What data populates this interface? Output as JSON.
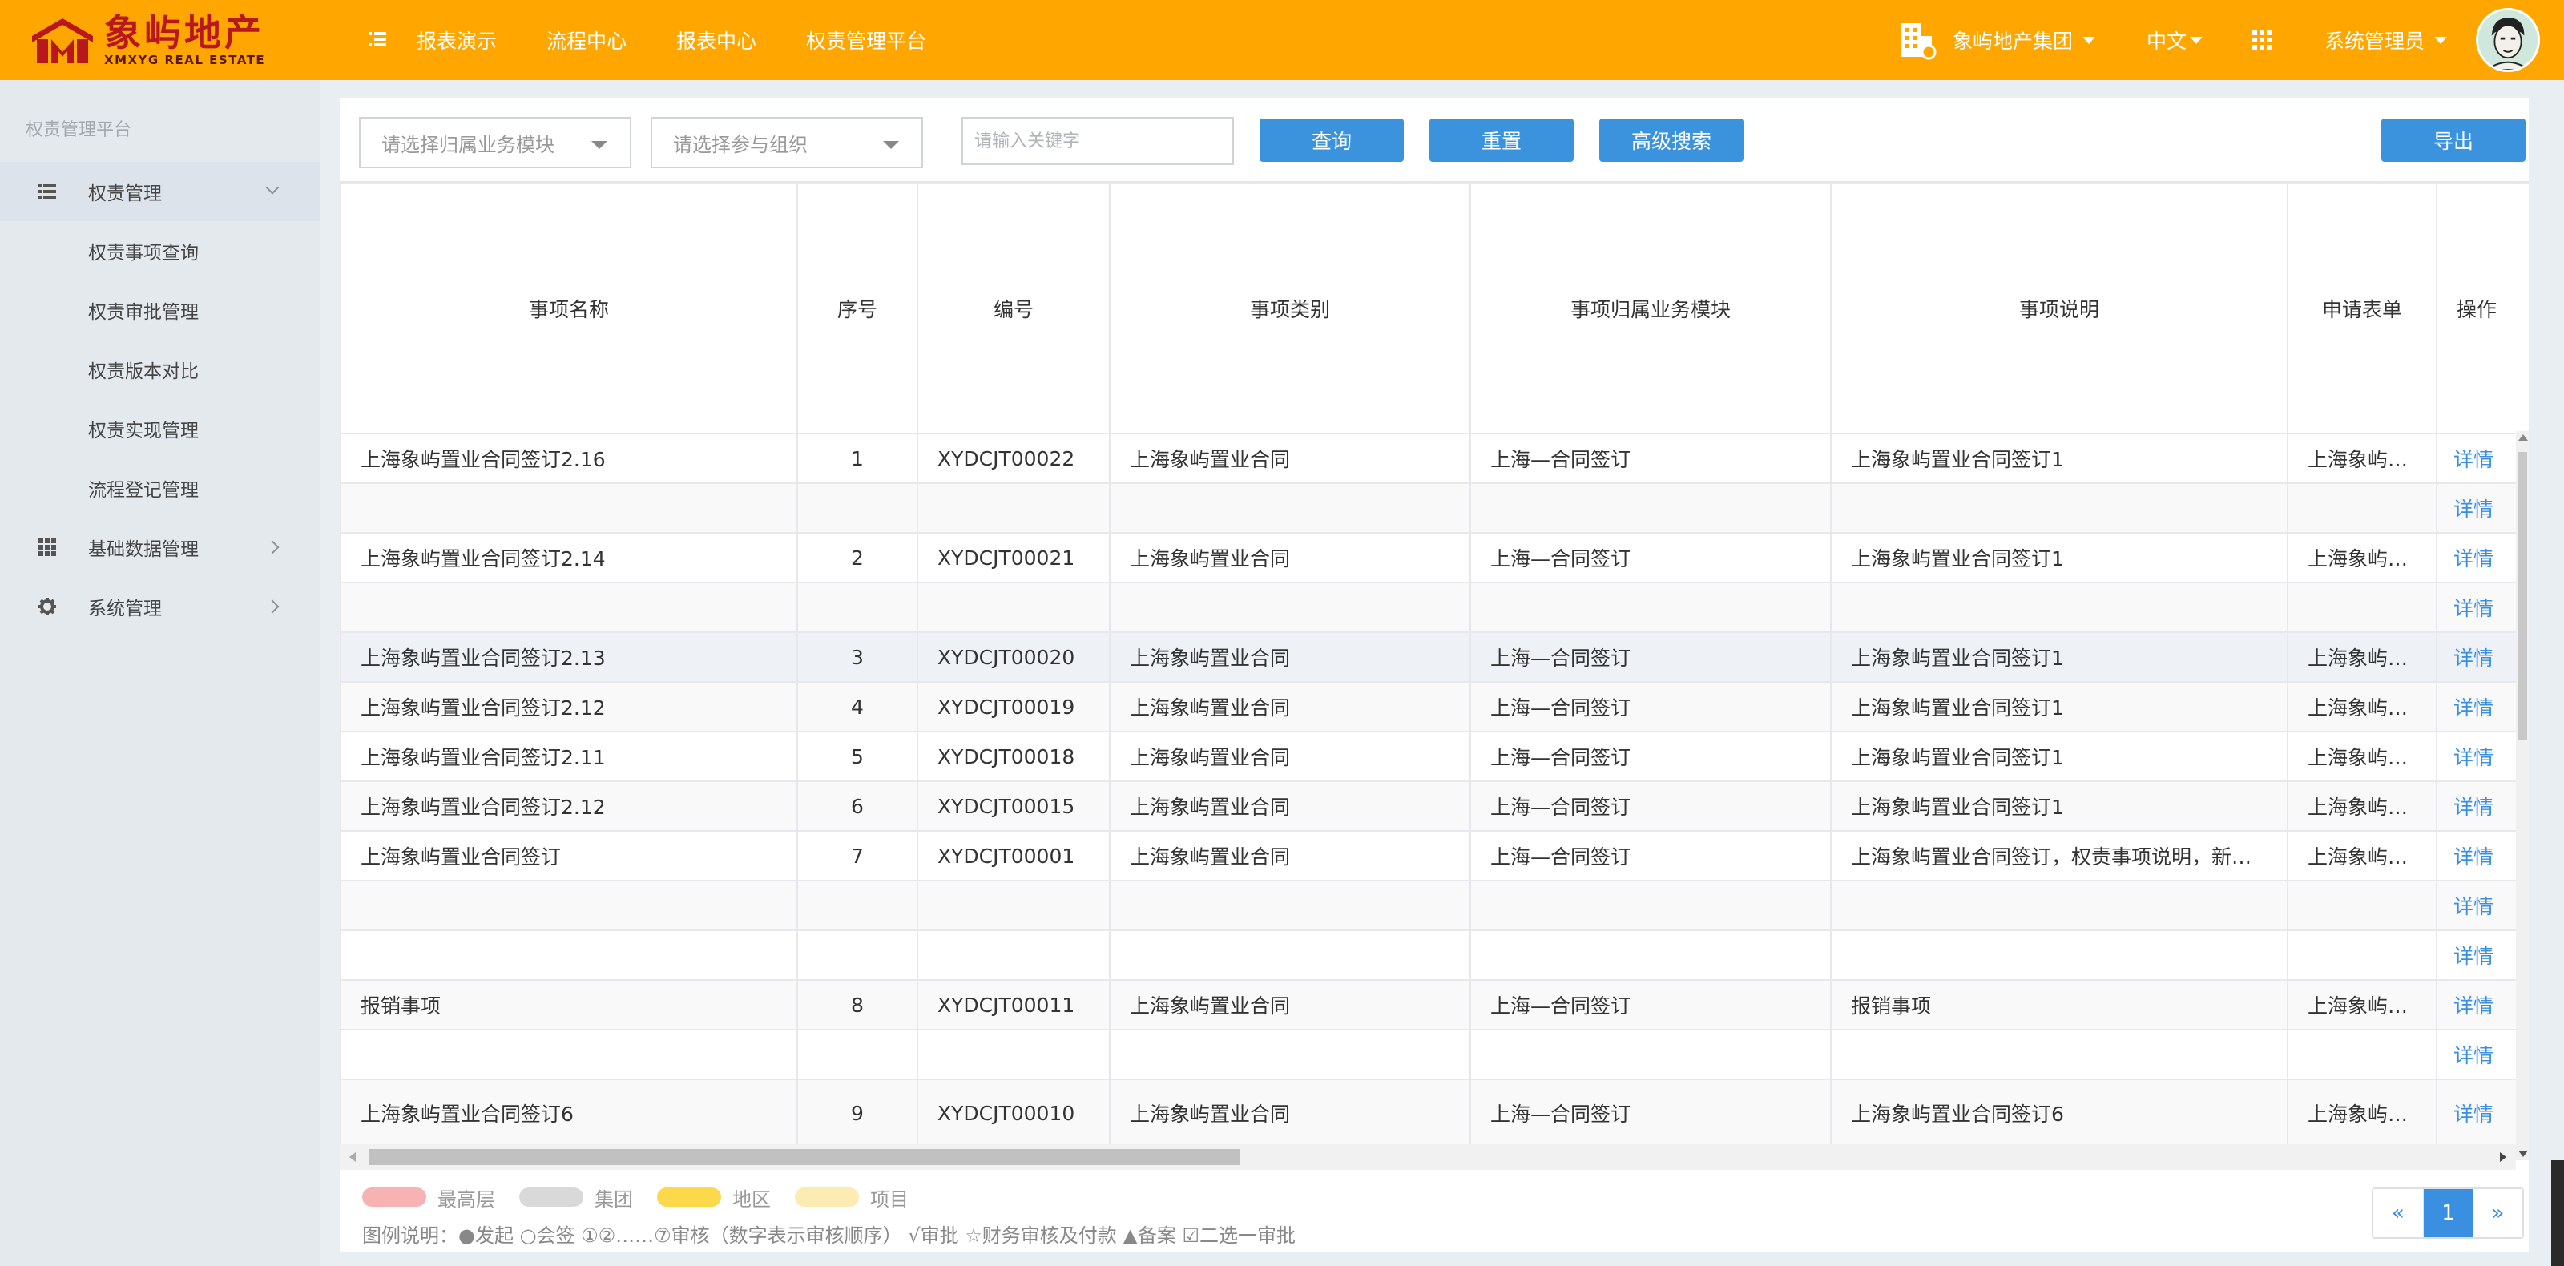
{
  "brand": {
    "name_cn": "象屿地产",
    "name_en": "XMXYG REAL ESTATE"
  },
  "topnav": {
    "items": [
      "报表演示",
      "流程中心",
      "报表中心",
      "权责管理平台"
    ],
    "org": "象屿地产集团",
    "lang": "中文",
    "user": "系统管理员"
  },
  "sidebar": {
    "title": "权责管理平台",
    "groups": [
      {
        "label": "权责管理",
        "icon": "list-icon",
        "expanded": true,
        "children": [
          "权责事项查询",
          "权责审批管理",
          "权责版本对比",
          "权责实现管理",
          "流程登记管理"
        ]
      },
      {
        "label": "基础数据管理",
        "icon": "grid-icon",
        "expanded": false
      },
      {
        "label": "系统管理",
        "icon": "gear-icon",
        "expanded": false
      }
    ]
  },
  "filters": {
    "module_placeholder": "请选择归属业务模块",
    "org_placeholder": "请选择参与组织",
    "keyword_placeholder": "请输入关键字",
    "query_label": "查询",
    "reset_label": "重置",
    "advanced_label": "高级搜索",
    "export_label": "导出"
  },
  "table": {
    "headers": [
      "事项名称",
      "序号",
      "编号",
      "事项类别",
      "事项归属业务模块",
      "事项说明",
      "申请表单",
      "操作"
    ],
    "action_label": "详情",
    "rows": [
      {
        "name": "上海象屿置业合同签订2.16",
        "seq": "1",
        "code": "XYDCJT00022",
        "category": "上海象屿置业合同",
        "module": "上海—合同签订",
        "desc": "上海象屿置业合同签订1",
        "form": "上海象屿置业…"
      },
      {
        "name": "",
        "seq": "",
        "code": "",
        "category": "",
        "module": "",
        "desc": "",
        "form": ""
      },
      {
        "name": "上海象屿置业合同签订2.14",
        "seq": "2",
        "code": "XYDCJT00021",
        "category": "上海象屿置业合同",
        "module": "上海—合同签订",
        "desc": "上海象屿置业合同签订1",
        "form": "上海象屿置业…"
      },
      {
        "name": "",
        "seq": "",
        "code": "",
        "category": "",
        "module": "",
        "desc": "",
        "form": ""
      },
      {
        "name": "上海象屿置业合同签订2.13",
        "seq": "3",
        "code": "XYDCJT00020",
        "category": "上海象屿置业合同",
        "module": "上海—合同签订",
        "desc": "上海象屿置业合同签订1",
        "form": "上海象屿置业…",
        "highlight": true
      },
      {
        "name": "上海象屿置业合同签订2.12",
        "seq": "4",
        "code": "XYDCJT00019",
        "category": "上海象屿置业合同",
        "module": "上海—合同签订",
        "desc": "上海象屿置业合同签订1",
        "form": "上海象屿置业…"
      },
      {
        "name": "上海象屿置业合同签订2.11",
        "seq": "5",
        "code": "XYDCJT00018",
        "category": "上海象屿置业合同",
        "module": "上海—合同签订",
        "desc": "上海象屿置业合同签订1",
        "form": "上海象屿置业…"
      },
      {
        "name": "上海象屿置业合同签订2.12",
        "seq": "6",
        "code": "XYDCJT00015",
        "category": "上海象屿置业合同",
        "module": "上海—合同签订",
        "desc": "上海象屿置业合同签订1",
        "form": "上海象屿置业…"
      },
      {
        "name": "上海象屿置业合同签订",
        "seq": "7",
        "code": "XYDCJT00001",
        "category": "上海象屿置业合同",
        "module": "上海—合同签订",
        "desc": "上海象屿置业合同签订，权责事项说明，新…",
        "form": "上海象屿置业…"
      },
      {
        "name": "",
        "seq": "",
        "code": "",
        "category": "",
        "module": "",
        "desc": "",
        "form": ""
      },
      {
        "name": "",
        "seq": "",
        "code": "",
        "category": "",
        "module": "",
        "desc": "",
        "form": ""
      },
      {
        "name": "报销事项",
        "seq": "8",
        "code": "XYDCJT00011",
        "category": "上海象屿置业合同",
        "module": "上海—合同签订",
        "desc": "报销事项",
        "form": "上海象屿置业…"
      },
      {
        "name": "",
        "seq": "",
        "code": "",
        "category": "",
        "module": "",
        "desc": "",
        "form": ""
      },
      {
        "name": "上海象屿置业合同签订6",
        "seq": "9",
        "code": "XYDCJT00010",
        "category": "上海象屿置业合同",
        "module": "上海—合同签订",
        "desc": "上海象屿置业合同签订6",
        "form": "上海象屿置业…",
        "tall": true
      }
    ]
  },
  "legend": {
    "items": [
      {
        "label": "最高层",
        "color": "#f7b3b3"
      },
      {
        "label": "集团",
        "color": "#d9d9d9"
      },
      {
        "label": "地区",
        "color": "#fbd94a"
      },
      {
        "label": "项目",
        "color": "#fcebb3"
      }
    ],
    "note": "图例说明：●发起 ○会签 ①②……⑦审核（数字表示审核顺序） √审批 ☆财务审核及付款 ▲备案 ☑二选一审批"
  },
  "pager": {
    "prev": "«",
    "current": "1",
    "next": "»"
  },
  "colors": {
    "topbar": "#ffa700",
    "accent": "#3a93dc",
    "link": "#3a8fe0"
  }
}
